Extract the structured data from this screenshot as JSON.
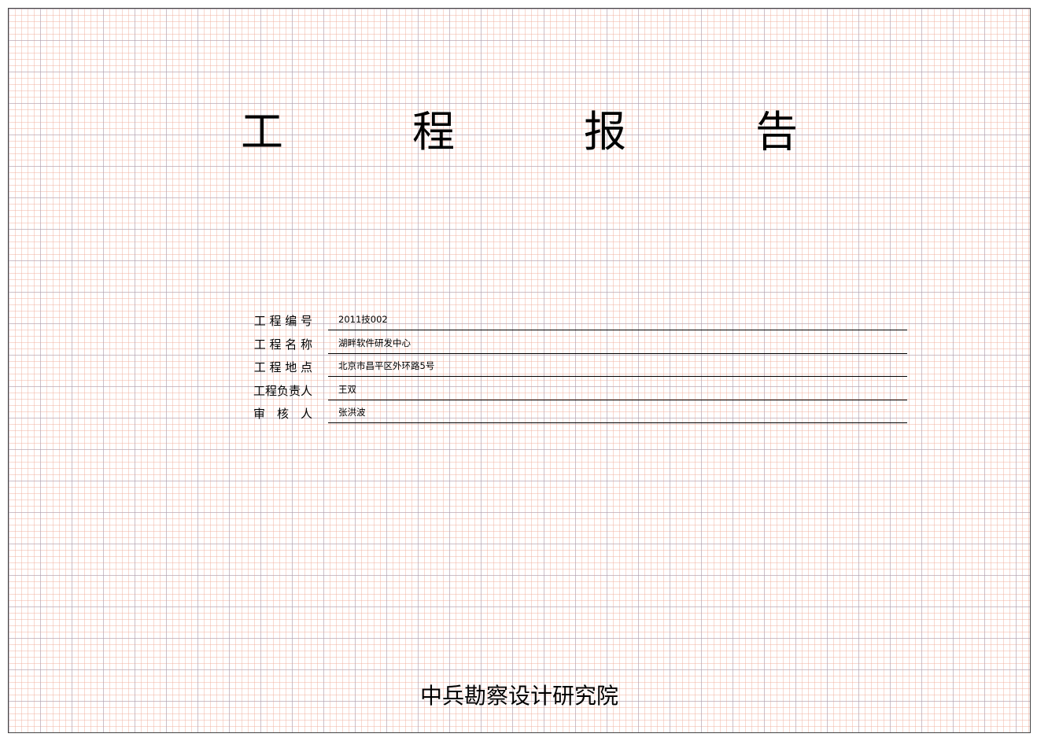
{
  "title": "工　程　报　告",
  "fields": [
    {
      "label": "工 程 编 号",
      "value": "2011技002"
    },
    {
      "label": "工 程 名 称",
      "value": "湖畔软件研发中心"
    },
    {
      "label": "工 程 地 点",
      "value": "北京市昌平区外环路5号"
    },
    {
      "label": "工程负责人",
      "value": "王双"
    },
    {
      "label": "审　核　人",
      "value": "张洪波"
    }
  ],
  "footer": "中兵勘察设计研究院"
}
